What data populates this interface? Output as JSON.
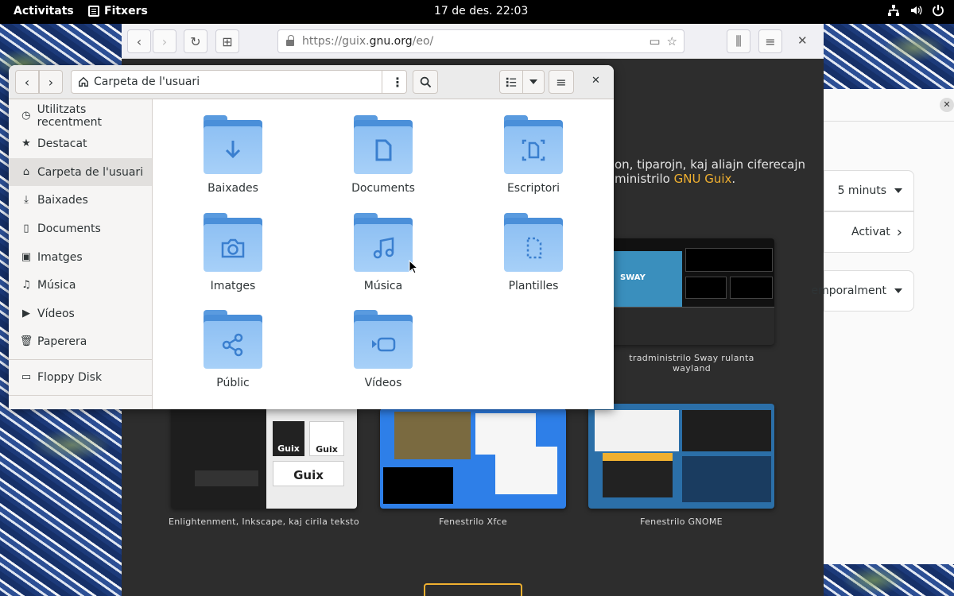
{
  "topbar": {
    "activities": "Activitats",
    "app_name": "Fitxers",
    "clock": "17 de des.  22:03"
  },
  "browser": {
    "url_prefix": "https://guix.",
    "url_host": "gnu.org",
    "url_path": "/eo/",
    "page_text_line1": "on, tiparojn, kaj aliajn ciferecajn",
    "page_text_line2_pre": "ministrilo ",
    "page_text_link": "GNU Guix",
    "page_text_line2_post": ".",
    "captions": [
      "tradministrilo Sway rulanta wayland",
      "Enlightenment, Inkscape, kaj cirila teksto",
      "Fenestrilo Xfce",
      "Fenestrilo GNOME"
    ],
    "shot_labels": {
      "sway": "SWAY",
      "guix1": "Guix",
      "guix2": "Guix",
      "guix3": "Guix"
    }
  },
  "settings_panel": {
    "row1": "5 minuts",
    "row2": "Activat",
    "row3": "emporalment"
  },
  "files": {
    "path": "Carpeta de l'usuari",
    "sidebar": [
      {
        "label": "Utilitzats recentment",
        "icon": "clock-icon"
      },
      {
        "label": "Destacat",
        "icon": "star-icon"
      },
      {
        "label": "Carpeta de l'usuari",
        "icon": "home-icon"
      },
      {
        "label": "Baixades",
        "icon": "download-icon"
      },
      {
        "label": "Documents",
        "icon": "document-icon"
      },
      {
        "label": "Imatges",
        "icon": "image-icon"
      },
      {
        "label": "Música",
        "icon": "music-icon"
      },
      {
        "label": "Vídeos",
        "icon": "video-icon"
      },
      {
        "label": "Paperera",
        "icon": "trash-icon"
      },
      {
        "label": "Floppy Disk",
        "icon": "floppy-icon"
      }
    ],
    "folders": [
      {
        "label": "Baixades",
        "icon": "download-icon"
      },
      {
        "label": "Documents",
        "icon": "document-icon"
      },
      {
        "label": "Escriptori",
        "icon": "desktop-icon"
      },
      {
        "label": "Imatges",
        "icon": "camera-icon"
      },
      {
        "label": "Música",
        "icon": "music-icon"
      },
      {
        "label": "Plantilles",
        "icon": "template-icon"
      },
      {
        "label": "Públic",
        "icon": "share-icon"
      },
      {
        "label": "Vídeos",
        "icon": "video-icon"
      }
    ]
  }
}
